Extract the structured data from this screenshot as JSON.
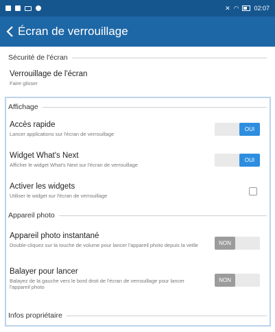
{
  "status_bar": {
    "time": "02:07",
    "left_icons": [
      "notification-icon",
      "lock-icon",
      "gallery-icon",
      "message-icon"
    ],
    "right_icons": [
      "nfc-icon",
      "wifi-icon",
      "battery-icon"
    ]
  },
  "app_bar": {
    "title": "Écran de verrouillage",
    "color": "#1e67a6"
  },
  "sections": {
    "security": {
      "header": "Sécurité de l'écran"
    },
    "display": {
      "header": "Affichage"
    },
    "photo": {
      "header": "Appareil photo"
    },
    "owner": {
      "header": "Infos propriétaire"
    }
  },
  "rows": {
    "screen_lock": {
      "title": "Verrouillage de l'écran",
      "sub": "Faire glisser"
    },
    "quick_access": {
      "title": "Accès rapide",
      "sub": "Lancer applications sur l'écran de verrouillage",
      "toggle": "OUI"
    },
    "whats_next": {
      "title": "Widget What's Next",
      "sub": "Afficher le widget What's Next sur l'écran de verrouillage",
      "toggle": "OUI"
    },
    "widgets": {
      "title": "Activer les widgets",
      "sub": "Utiliser le widget sur l'écran de verrouillage"
    },
    "instant_camera": {
      "title": "Appareil photo instantané",
      "sub": "Double-cliquez sur la touche de volume pour lancer l'appareil photo depuis la veille",
      "toggle": "NON"
    },
    "swipe_launch": {
      "title": "Balayer pour lancer",
      "sub": "Balayez de la gauche vers le bord droit de l'écran de verrouillage pour lancer l'appareil photo",
      "toggle": "NON"
    }
  },
  "colors": {
    "toggle_on": "#2d8ee0",
    "toggle_off": "#9c9c9c",
    "status_bar": "#16568f"
  }
}
